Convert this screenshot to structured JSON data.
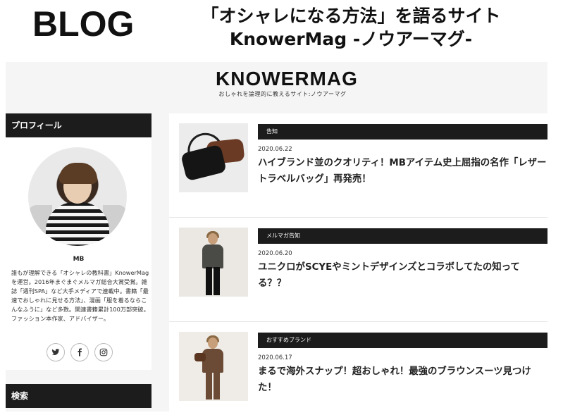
{
  "banner": {
    "label": "BLOG",
    "title_line1": "「オシャレになる方法」を語るサイト",
    "title_line2": "KnowerMag -ノウアーマグ-"
  },
  "site": {
    "logo": "KNOWERMAG",
    "tagline": "おしゃれを論理的に教えるサイト:ノウアーマグ"
  },
  "sidebar": {
    "profile_heading": "プロフィール",
    "profile_name": "MB",
    "profile_text": "誰もが理解できる「オシャレの教科書」KnowerMagを運営。2016年まぐまぐメルマガ総合大賞受賞。雑誌「週刊SPA」など大手メディアで連載中。書籍「最速でおしゃれに見せる方法」、漫画「服を着るならこんなふうに」など多数。関連書籍累計100万部突破。ファッション本作家、アドバイザー。",
    "social": [
      {
        "label": "Twitter",
        "icon": "twitter-icon"
      },
      {
        "label": "Facebook",
        "icon": "facebook-icon"
      },
      {
        "label": "Instagram",
        "icon": "instagram-icon"
      }
    ],
    "search_heading": "検索"
  },
  "posts": [
    {
      "tag": "告知",
      "date": "2020.06.22",
      "title": "ハイブランド並のクオリティ！MBアイテム史上屈指の名作「レザートラベルバッグ」再発売！"
    },
    {
      "tag": "メルマガ告知",
      "date": "2020.06.20",
      "title": "ユニクロがSCYEやミントデザインズとコラボしてたの知ってる？？"
    },
    {
      "tag": "おすすめブランド",
      "date": "2020.06.17",
      "title": "まるで海外スナップ！超おしゃれ！最強のブラウンスーツ見つけた！"
    }
  ]
}
